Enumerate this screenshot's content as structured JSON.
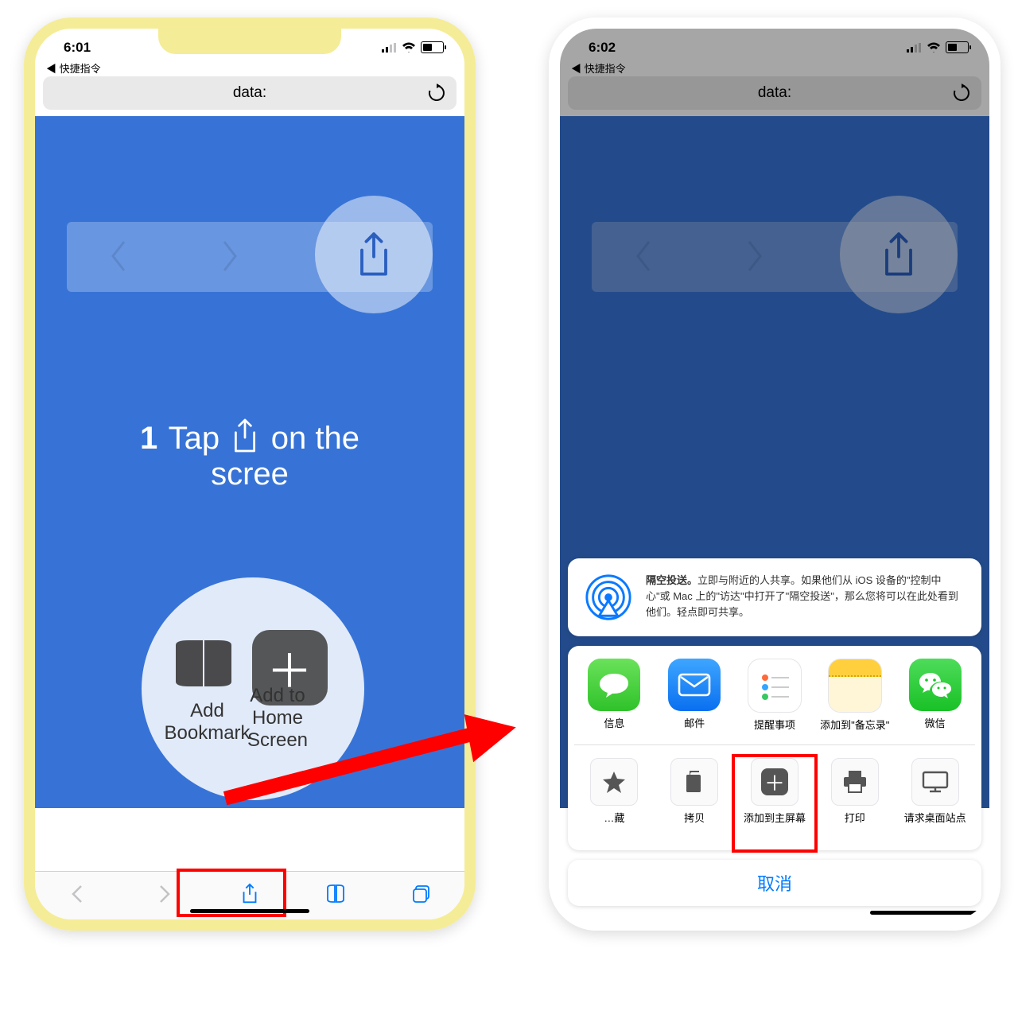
{
  "left": {
    "status_time": "6:01",
    "return": "◀ 快捷指令",
    "url": "data:",
    "step_num": "1",
    "step_word": "Tap",
    "step_after": "on the",
    "step_line2": "scree",
    "zoom_left": "Add\nBookmark",
    "zoom_right": "Add to\nHome Screen"
  },
  "right": {
    "status_time": "6:02",
    "return": "◀ 快捷指令",
    "url": "data:",
    "airdrop_title": "隔空投送。",
    "airdrop_text": "立即与附近的人共享。如果他们从 iOS 设备的\"控制中心\"或 Mac 上的\"访达\"中打开了\"隔空投送\"，那么您将可以在此处看到他们。轻点即可共享。",
    "apps": [
      {
        "label": "信息"
      },
      {
        "label": "邮件"
      },
      {
        "label": "提醒事项"
      },
      {
        "label": "添加到\"备忘录\""
      },
      {
        "label": "微信"
      }
    ],
    "actions": [
      {
        "label": "…藏"
      },
      {
        "label": "拷贝"
      },
      {
        "label": "添加到主屏幕"
      },
      {
        "label": "打印"
      },
      {
        "label": "请求桌面站点"
      }
    ],
    "cancel": "取消"
  }
}
